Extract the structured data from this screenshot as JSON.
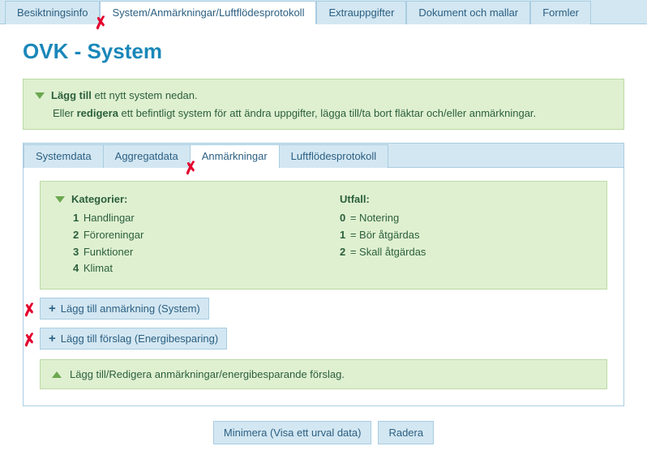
{
  "topTabs": {
    "t0": "Besiktningsinfo",
    "t1": "System/Anmärkningar/Luftflödesprotokoll",
    "t2": "Extrauppgifter",
    "t3": "Dokument och mallar",
    "t4": "Formler"
  },
  "pageTitle": "OVK - System",
  "greenTop": {
    "line1_pre": "Lägg till",
    "line1_post": " ett nytt system nedan.",
    "line2_pre": "Eller ",
    "line2_bold": "redigera",
    "line2_post": " ett befintligt system för att ändra uppgifter, lägga till/ta bort fläktar och/eller anmärkningar."
  },
  "innerTabs": {
    "t0": "Systemdata",
    "t1": "Aggregatdata",
    "t2": "Anmärkningar",
    "t3": "Luftflödesprotokoll"
  },
  "catBox": {
    "headLeft": "Kategorier:",
    "headRight": "Utfall:",
    "left": {
      "n1": "1",
      "l1": "Handlingar",
      "n2": "2",
      "l2": "Föroreningar",
      "n3": "3",
      "l3": "Funktioner",
      "n4": "4",
      "l4": "Klimat"
    },
    "right": {
      "n0": "0",
      "l0": " = Notering",
      "n1": "1",
      "l1": " = Bör åtgärdas",
      "n2": "2",
      "l2": " = Skall åtgärdas"
    }
  },
  "btnAddRemark": "Lägg till anmärkning (System)",
  "btnAddEnergy": "Lägg till förslag (Energibesparing)",
  "hint": "Lägg till/Redigera anmärkningar/energibesparande förslag.",
  "footer": {
    "minimize": "Minimera (Visa ett urval data)",
    "delete": "Radera"
  }
}
